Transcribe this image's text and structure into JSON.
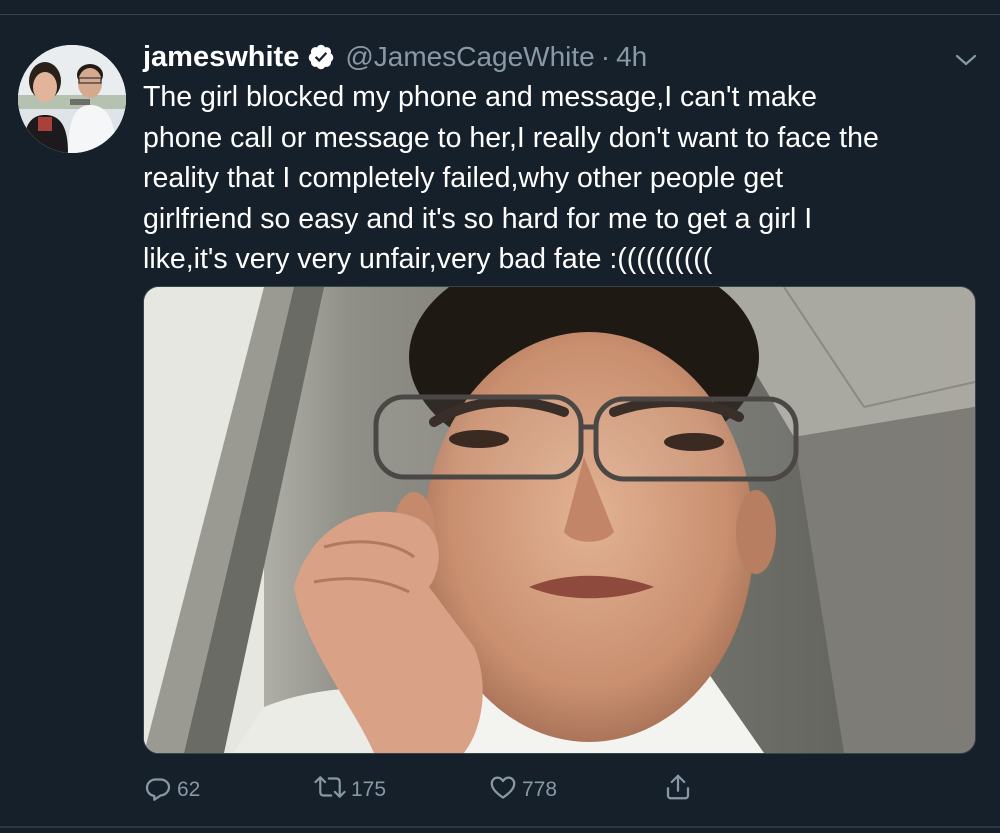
{
  "tweet": {
    "display_name": "jameswhite",
    "handle": "@JamesCageWhite",
    "separator": "·",
    "time": "4h",
    "text_lines": [
      "The girl blocked my phone and message,I can't make",
      "phone call or message to her,I really don't want to face the",
      "reality that I completely failed,why other people get",
      "girlfriend so easy and it's so hard for me to get a girl I",
      "like,it's very very unfair,very bad fate :(((((((((("
    ],
    "actions": {
      "replies": "62",
      "retweets": "175",
      "likes": "778"
    }
  },
  "icons": {
    "verified": "verified-badge-icon",
    "caret": "chevron-down-icon",
    "reply": "reply-icon",
    "retweet": "retweet-icon",
    "like": "heart-icon",
    "share": "share-icon"
  },
  "colors": {
    "background": "#15202b",
    "text": "#ffffff",
    "muted": "#8899a6",
    "divider": "#38444d"
  }
}
